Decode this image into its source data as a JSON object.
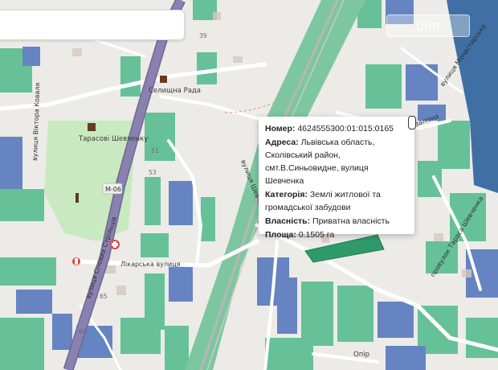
{
  "search": {
    "value": "",
    "placeholder": ""
  },
  "watermark": "dim",
  "popup": {
    "fields": [
      {
        "key": "Номер:",
        "value": "4624555300:01:015:0165"
      },
      {
        "key": "Адреса:",
        "value": "Львівська область, Сколівський район, смт.В.Синьовидне, вулиця Шевченка"
      },
      {
        "key": "Категорія:",
        "value": "Землі житлової та громадської забудови"
      },
      {
        "key": "Власність:",
        "value": "Приватна власність"
      },
      {
        "key": "Площа:",
        "value": "0.1505 га"
      }
    ],
    "close_icon": "close-icon"
  },
  "map": {
    "streets": {
      "viktora_kovalia": "вулиця Віктора Коваля",
      "sichovykh_striltsiv": "вулиця Січових Стрільців",
      "likarska": "Лікарська вулиця",
      "shevchenka": "вулиця Шевченка",
      "provulok_shevchenka": "провулок Тараса Шевченка",
      "monastyrska": "вулиця Монастирська",
      "zaliznychna_partial": "залізна"
    },
    "road_ref": "M-06",
    "pois": {
      "monument": "Тарасові Шевченку",
      "council": "Селищна Рада",
      "opir": "Опір"
    },
    "house_numbers": [
      "39",
      "51",
      "53",
      "65",
      "69"
    ],
    "colors": {
      "parcel_green": "#5fbf95",
      "parcel_blue": "#5f7fc0",
      "highway": "#8a80b2",
      "rail_band": "#7dc7a0",
      "park": "#c5e9b9",
      "water": "#3f6fa3",
      "popup_bg": "#ffffff"
    }
  }
}
